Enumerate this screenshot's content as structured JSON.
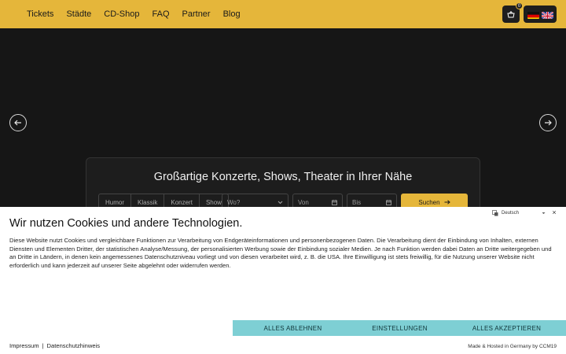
{
  "nav": {
    "items": [
      "Tickets",
      "Städte",
      "CD-Shop",
      "FAQ",
      "Partner",
      "Blog"
    ],
    "cart_count": "0"
  },
  "hero": {
    "search": {
      "title": "Großartige Konzerte, Shows, Theater in Ihrer Nähe",
      "categories": [
        "Humor",
        "Klassik",
        "Konzert",
        "Show"
      ],
      "where_placeholder": "Wo?",
      "from_placeholder": "Von",
      "to_placeholder": "Bis",
      "submit_label": "Suchen"
    }
  },
  "cookie": {
    "language": "Deutsch",
    "close": "×",
    "title": "Wir nutzen Cookies und andere Technologien.",
    "text": "Diese Website nutzt Cookies und vergleichbare Funktionen zur Verarbeitung von Endgeräteinformationen und personenbezogenen Daten. Die Verarbeitung dient der Einbindung von Inhalten, externen Diensten und Elementen Dritter, der statistischen Analyse/Messung, der personalisierten Werbung sowie der Einbindung sozialer Medien. Je nach Funktion werden dabei Daten an Dritte weitergegeben und an Dritte in Ländern, in denen kein angemessenes Datenschutzniveau vorliegt und von diesen verarbeitet wird, z. B. die USA. Ihre Einwilligung ist stets freiwillig, für die Nutzung unserer Website nicht erforderlich und kann jederzeit auf unserer Seite abgelehnt oder widerrufen werden.",
    "buttons": {
      "reject": "ALLES ABLEHNEN",
      "settings": "EINSTELLUNGEN",
      "accept": "ALLES AKZEPTIEREN"
    },
    "links": {
      "imprint": "Impressum",
      "separator": "|",
      "privacy": "Datenschutzhinweis"
    },
    "hosted": "Made & Hosted in Germany by CCM19"
  },
  "colors": {
    "brand": "#e5b63a",
    "hero_bg": "#161616",
    "cookie_button": "#7ecfd4"
  },
  "icons": {
    "cart": "basket-icon",
    "prev": "arrow-left-icon",
    "next": "arrow-right-icon",
    "where": "chevron-down-icon",
    "date": "calendar-icon",
    "submit": "arrow-right-icon",
    "language": "translate-icon"
  }
}
